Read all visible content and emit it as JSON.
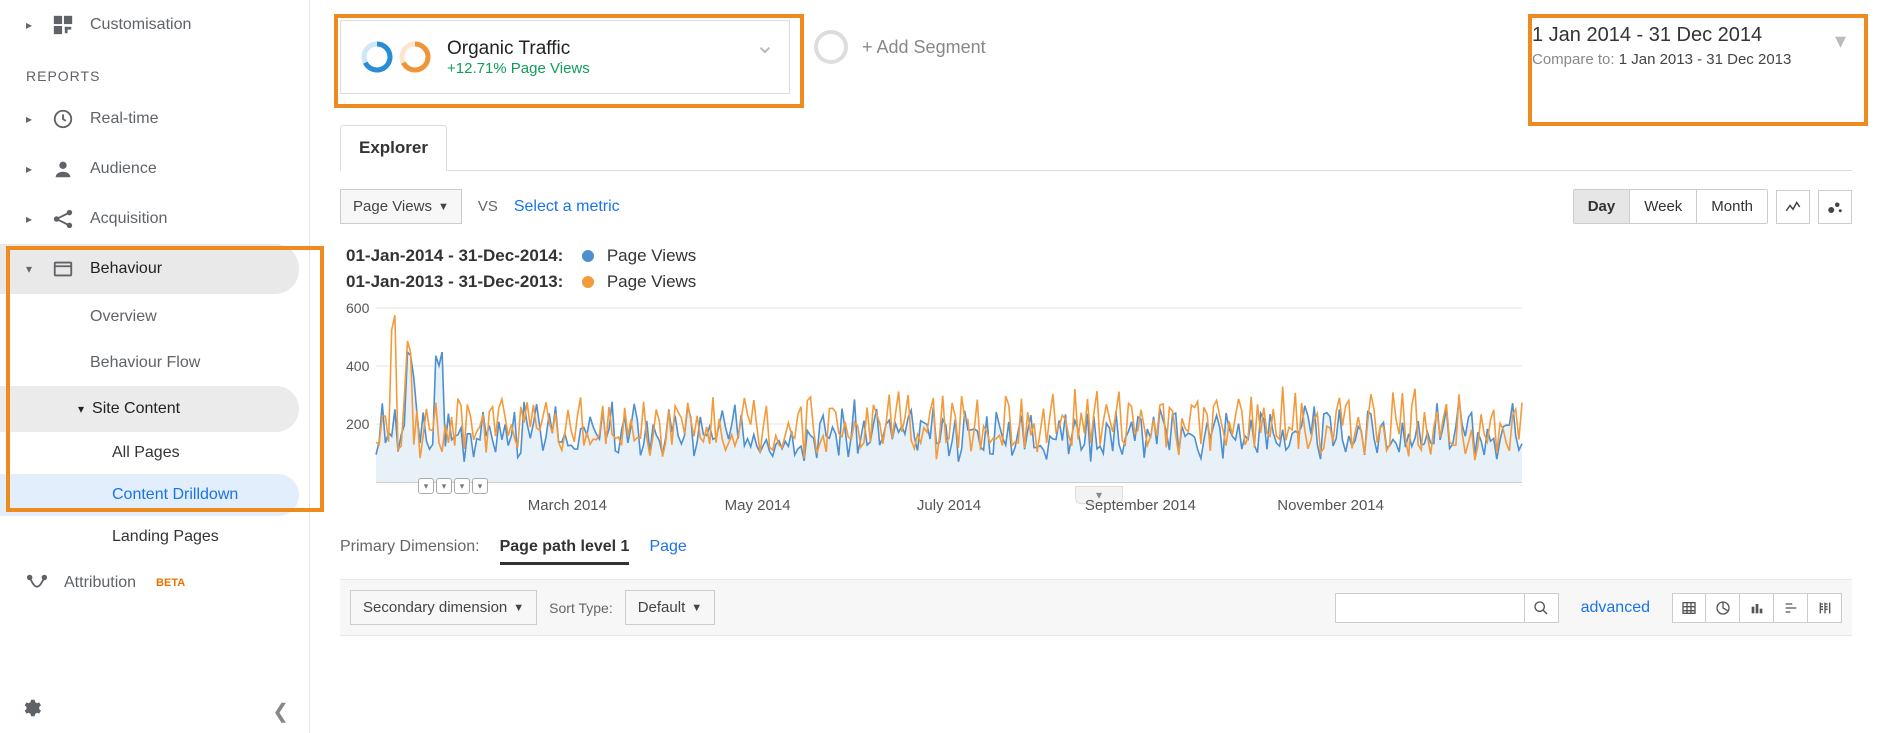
{
  "sidebar": {
    "customisation": "Customisation",
    "reports_heading": "REPORTS",
    "realtime": "Real-time",
    "audience": "Audience",
    "acquisition": "Acquisition",
    "behaviour": "Behaviour",
    "overview": "Overview",
    "behaviour_flow": "Behaviour Flow",
    "site_content": "Site Content",
    "all_pages": "All Pages",
    "content_drilldown": "Content Drilldown",
    "landing_pages": "Landing Pages",
    "attribution": "Attribution",
    "beta": "BETA"
  },
  "segment": {
    "title": "Organic Traffic",
    "change": "+12.71% Page Views",
    "add": "+ Add Segment"
  },
  "date": {
    "range": "1 Jan 2014 - 31 Dec 2014",
    "compare_label": "Compare to:",
    "compare_range": "1 Jan 2013 - 31 Dec 2013"
  },
  "tab_explorer": "Explorer",
  "metric": {
    "primary": "Page Views",
    "vs": "VS",
    "select": "Select a metric"
  },
  "granularity": {
    "day": "Day",
    "week": "Week",
    "month": "Month"
  },
  "legend": {
    "r1_range": "01-Jan-2014 - 31-Dec-2014:",
    "r1_metric": "Page Views",
    "r2_range": "01-Jan-2013 - 31-Dec-2013:",
    "r2_metric": "Page Views"
  },
  "dimension": {
    "lead": "Primary Dimension:",
    "selected": "Page path level 1",
    "page": "Page"
  },
  "secondary": {
    "btn": "Secondary dimension",
    "sort_label": "Sort Type:",
    "sort_value": "Default",
    "advanced": "advanced"
  },
  "chart_data": {
    "type": "line",
    "ylim": [
      0,
      600
    ],
    "yticks": [
      200,
      400,
      600
    ],
    "x_categories": [
      "March 2014",
      "May 2014",
      "July 2014",
      "September 2014",
      "November 2014"
    ],
    "x_positions": [
      0.167,
      0.333,
      0.5,
      0.667,
      0.833
    ],
    "n_points": 365,
    "series": [
      {
        "name": "2014",
        "color": "#4e8fd0",
        "band": [
          40,
          260
        ],
        "spikes_at": [
          0.03,
          0.055
        ],
        "spike_val": 420
      },
      {
        "name": "2013",
        "color": "#f39a3b",
        "band": [
          40,
          300
        ],
        "spikes_at": [
          0.015,
          0.028
        ],
        "spike_val": 500
      }
    ]
  }
}
